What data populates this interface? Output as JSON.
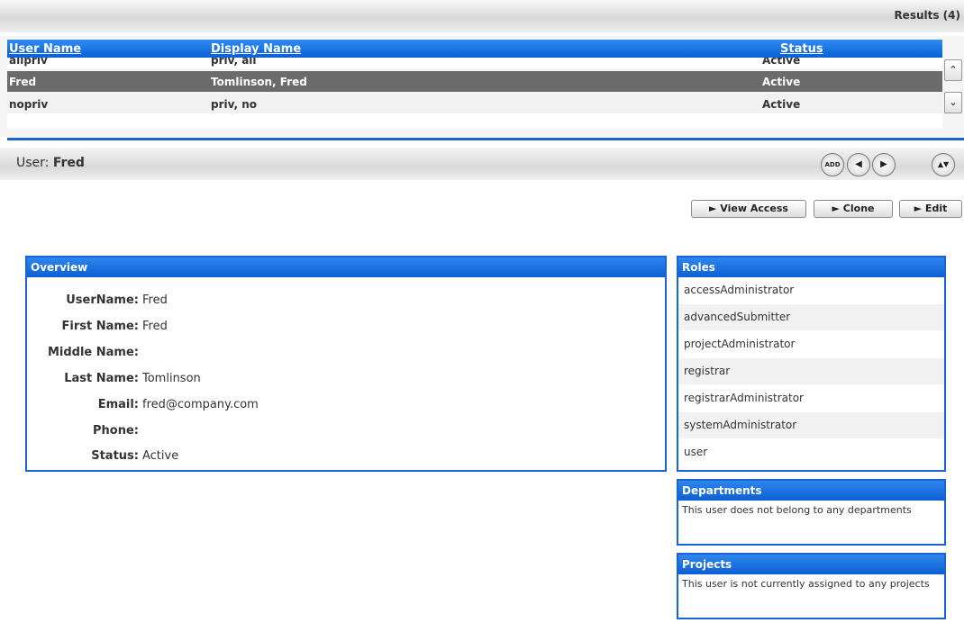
{
  "results": {
    "label": "Results (4)"
  },
  "table": {
    "headers": {
      "user_name": "User Name",
      "display_name": "Display Name",
      "status": "Status"
    },
    "rows": [
      {
        "user_name": "allpriv",
        "display_name": "priv, all",
        "status": "Active"
      },
      {
        "user_name": "Fred",
        "display_name": "Tomlinson, Fred",
        "status": "Active"
      },
      {
        "user_name": "nopriv",
        "display_name": "priv, no",
        "status": "Active"
      }
    ],
    "scroll_up_icon": "chevron-up-icon",
    "scroll_down_icon": "chevron-down-icon"
  },
  "detail": {
    "heading_prefix": "User: ",
    "heading_user": "Fred",
    "nav_buttons": [
      {
        "icon": "add-icon",
        "glyph": "ADD"
      },
      {
        "icon": "previous-icon",
        "glyph": "◀"
      },
      {
        "icon": "next-icon",
        "glyph": "▶"
      },
      {
        "icon": "expand-icon",
        "glyph": "▲▼"
      }
    ],
    "actions": {
      "view_access": "► View Access",
      "clone": "► Clone",
      "edit": "► Edit"
    }
  },
  "overview": {
    "title": "Overview",
    "fields": [
      {
        "label": "UserName:",
        "value": "Fred"
      },
      {
        "label": "First Name:",
        "value": "Fred"
      },
      {
        "label": "Middle Name:",
        "value": ""
      },
      {
        "label": "Last Name:",
        "value": "Tomlinson"
      },
      {
        "label": "Email:",
        "value": "fred@company.com"
      },
      {
        "label": "Phone:",
        "value": ""
      },
      {
        "label": "Status:",
        "value": "Active"
      }
    ]
  },
  "roles": {
    "title": "Roles",
    "items": [
      "accessAdministrator",
      "advancedSubmitter",
      "projectAdministrator",
      "registrar",
      "registrarAdministrator",
      "systemAdministrator",
      "user"
    ]
  },
  "departments": {
    "title": "Departments",
    "text": "This user does not belong to any departments"
  },
  "projects": {
    "title": "Projects",
    "text": "This user is not currently assigned to any projects"
  },
  "colors": {
    "accent": "#1a63d4",
    "header_blue": "#0d5fd3",
    "selected_row": "#6b6b6b"
  }
}
